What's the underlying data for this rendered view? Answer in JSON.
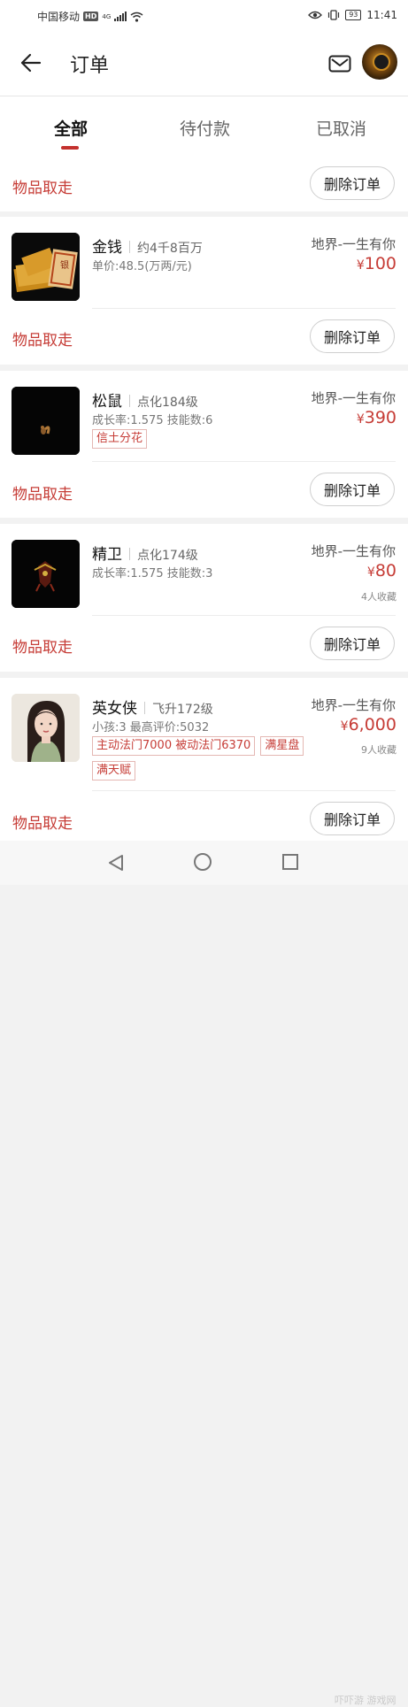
{
  "status_bar": {
    "carrier": "中国移动",
    "hd": "HD",
    "network": "4G",
    "battery": "93",
    "time": "11:41"
  },
  "header": {
    "title": "订单",
    "back_icon": "back-arrow-icon",
    "mail_icon": "mail-icon"
  },
  "tabs": [
    {
      "label": "全部",
      "active": true
    },
    {
      "label": "待付款",
      "active": false
    },
    {
      "label": "已取消",
      "active": false
    }
  ],
  "top_strip": {
    "pickup_label": "物品取走",
    "delete_label": "删除订单"
  },
  "orders": [
    {
      "name": "金钱",
      "tagline": "约4千8百万",
      "sub": "单价:48.5(万两/元)",
      "tags": [],
      "server": "地界-一生有你",
      "price_symbol": "¥",
      "price": "100",
      "favs": "",
      "pickup_label": "物品取走",
      "delete_label": "删除订单"
    },
    {
      "name": "松鼠",
      "tagline": "点化184级",
      "sub": "成长率:1.575 技能数:6",
      "tags": [
        "信土分花"
      ],
      "server": "地界-一生有你",
      "price_symbol": "¥",
      "price": "390",
      "favs": "",
      "pickup_label": "物品取走",
      "delete_label": "删除订单"
    },
    {
      "name": "精卫",
      "tagline": "点化174级",
      "sub": "成长率:1.575 技能数:3",
      "tags": [],
      "server": "地界-一生有你",
      "price_symbol": "¥",
      "price": "80",
      "favs": "4人收藏",
      "pickup_label": "物品取走",
      "delete_label": "删除订单"
    },
    {
      "name": "英女侠",
      "tagline": "飞升172级",
      "sub": "小孩:3 最高评价:5032",
      "tags": [
        "主动法门7000 被动法门6370",
        "满星盘",
        "满天赋"
      ],
      "server": "地界-一生有你",
      "price_symbol": "¥",
      "price": "6,000",
      "favs": "9人收藏",
      "pickup_label": "物品取走",
      "delete_label": "删除订单"
    }
  ],
  "watermark": "吓吓游 游戏网",
  "colors": {
    "accent": "#c63c36",
    "background": "#f2f2f2"
  }
}
